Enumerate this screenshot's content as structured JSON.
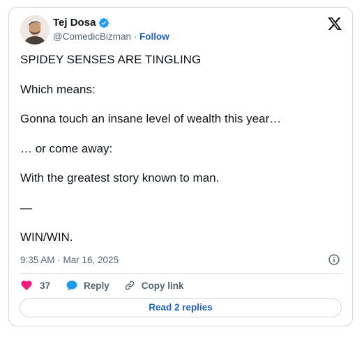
{
  "author": {
    "name": "Tej Dosa",
    "handle": "@ComedicBizman",
    "separator": "·",
    "follow_label": "Follow",
    "verified": true
  },
  "platform_icon": "x-logo-icon",
  "tweet": {
    "lines": [
      "SPIDEY SENSES ARE TINGLING",
      "Which means:",
      "Gonna touch an insane level of wealth this year…",
      "… or come away:",
      "With the greatest story known to man.",
      "—",
      "WIN/WIN."
    ]
  },
  "meta": {
    "timestamp": "9:35 AM · Mar 16, 2025"
  },
  "actions": {
    "likes_count": "37",
    "reply_label": "Reply",
    "copy_link_label": "Copy link"
  },
  "replies_button_label": "Read 2 replies",
  "colors": {
    "accent": "#1d64c0",
    "verified": "#1d9bf0",
    "heart": "#f91880",
    "border": "#cfd9de",
    "muted": "#536471"
  }
}
